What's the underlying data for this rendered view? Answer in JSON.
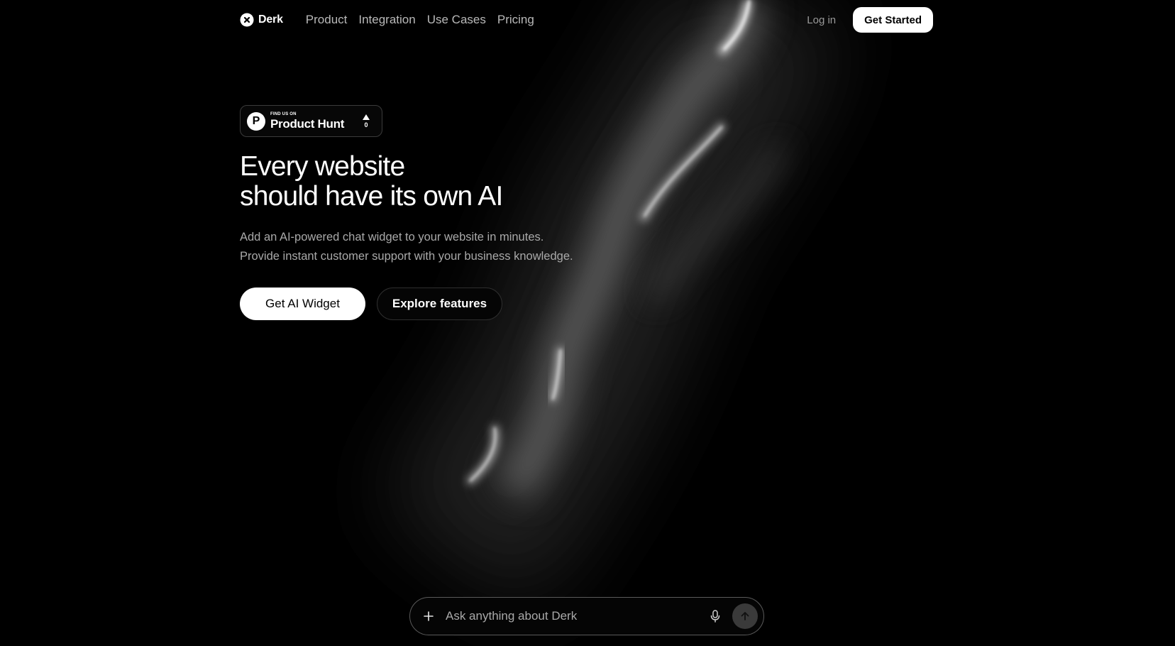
{
  "nav": {
    "brand": "Derk",
    "links": [
      "Product",
      "Integration",
      "Use Cases",
      "Pricing"
    ],
    "login": "Log in",
    "cta": "Get Started"
  },
  "badge": {
    "small": "FIND US ON",
    "big": "Product Hunt",
    "votes": "0"
  },
  "hero": {
    "headline_line1": "Every website",
    "headline_line2": "should have its own AI",
    "sub_line1": "Add an AI-powered chat widget to your website in minutes.",
    "sub_line2": "Provide instant customer support with your business knowledge.",
    "primary_cta": "Get AI Widget",
    "secondary_cta": "Explore features"
  },
  "chat": {
    "placeholder": "Ask anything about Derk"
  },
  "icons": {
    "logo": "x-circle-icon",
    "badge_logo": "product-hunt-logo",
    "upvote": "triangle-up-icon",
    "add": "plus-icon",
    "mic": "microphone-icon",
    "send": "arrow-up-icon"
  },
  "colors": {
    "background": "#000000",
    "primary_button": "#ffffff",
    "muted_text": "#a9a9a9",
    "send_button": "#3a3a3a"
  }
}
